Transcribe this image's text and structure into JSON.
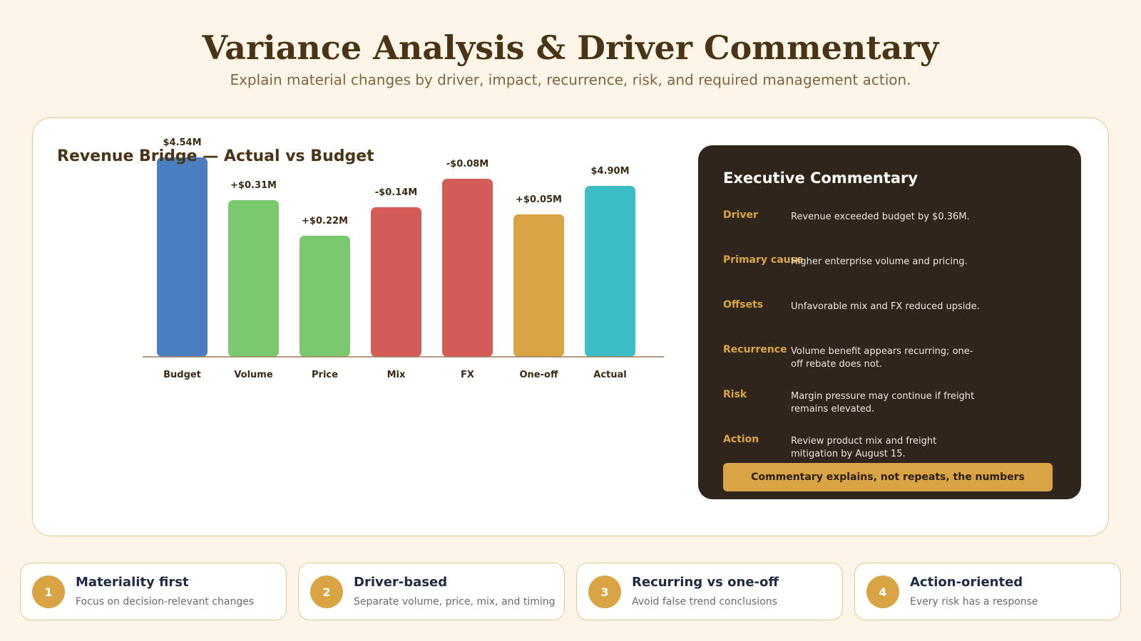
{
  "header": {
    "title": "Variance Analysis & Driver Commentary",
    "subtitle": "Explain material changes by driver, impact, recurrence, risk, and required management action."
  },
  "chart_data": {
    "type": "bar",
    "title": "Revenue Bridge — Actual vs Budget",
    "categories": [
      "Budget",
      "Volume",
      "Price",
      "Mix",
      "FX",
      "One-off",
      "Actual"
    ],
    "values": [
      4.54,
      0.31,
      0.22,
      -0.14,
      -0.08,
      0.05,
      4.9
    ],
    "data_labels": [
      "$4.54M",
      "+$0.31M",
      "+$0.22M",
      "-$0.14M",
      "-$0.08M",
      "+$0.05M",
      "$4.90M"
    ],
    "colors": [
      "#4a7fc1",
      "#7bc96f",
      "#7bc96f",
      "#d45c57",
      "#d45c57",
      "#d9a443",
      "#3bbec6"
    ],
    "xlabel": "",
    "ylabel": "",
    "grid": false,
    "legend": "none"
  },
  "commentary": {
    "title": "Executive Commentary",
    "rows": [
      {
        "label": "Driver",
        "text": "Revenue exceeded budget by $0.36M."
      },
      {
        "label": "Primary cause",
        "text": "Higher enterprise volume and pricing."
      },
      {
        "label": "Offsets",
        "text": "Unfavorable mix and FX reduced upside."
      },
      {
        "label": "Recurrence",
        "text": "Volume benefit appears recurring; one-off rebate does not."
      },
      {
        "label": "Risk",
        "text": "Margin pressure may continue if freight remains elevated."
      },
      {
        "label": "Action",
        "text": "Review product mix and freight mitigation by August 15."
      }
    ],
    "callout": "Commentary explains, not repeats, the numbers"
  },
  "principles": [
    {
      "number": "1",
      "title": "Materiality first",
      "desc": "Focus on decision-relevant changes"
    },
    {
      "number": "2",
      "title": "Driver-based",
      "desc": "Separate volume, price, mix, and timing"
    },
    {
      "number": "3",
      "title": "Recurring vs one-off",
      "desc": "Avoid false trend conclusions"
    },
    {
      "number": "4",
      "title": "Action-oriented",
      "desc": "Every risk has a response"
    }
  ]
}
